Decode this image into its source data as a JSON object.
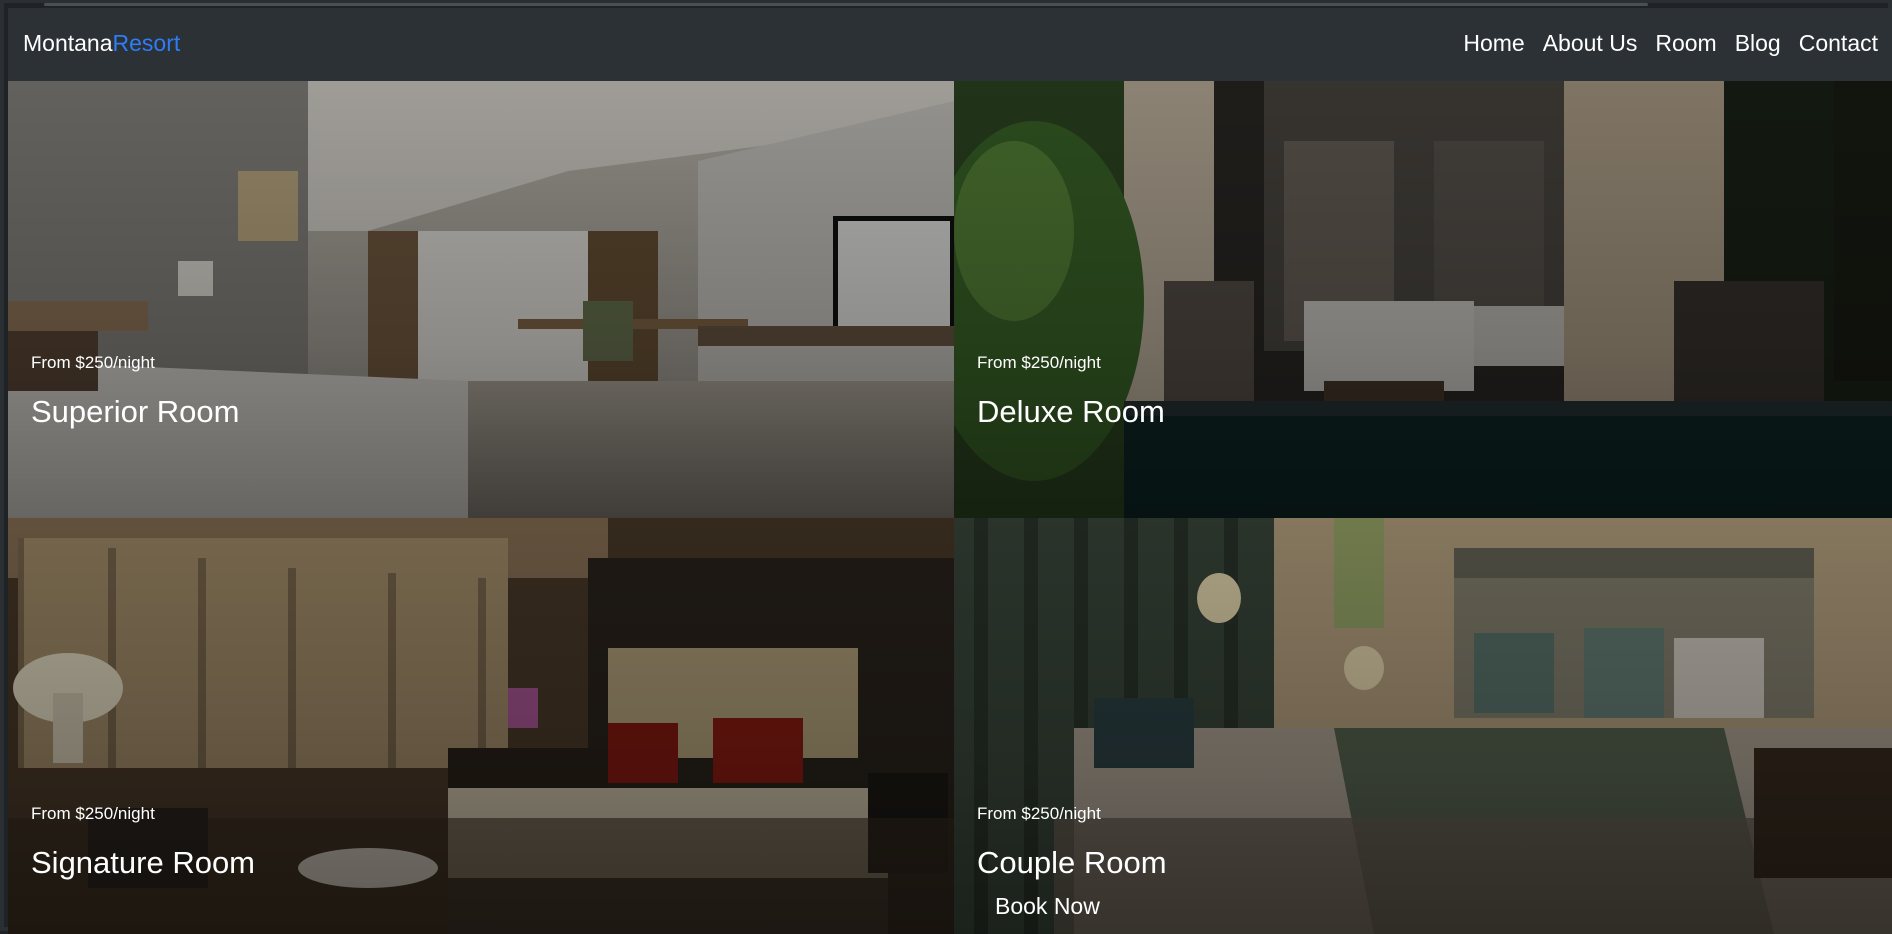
{
  "header": {
    "brand_main": "Montana",
    "brand_accent": "Resort",
    "nav": [
      "Home",
      "About Us",
      "Room",
      "Blog",
      "Contact"
    ]
  },
  "rooms": [
    {
      "price": "From $250/night",
      "name": "Superior Room"
    },
    {
      "price": "From $250/night",
      "name": "Deluxe Room"
    },
    {
      "price": "From $250/night",
      "name": "Signature Room"
    },
    {
      "price": "From $250/night",
      "name": "Couple Room",
      "cta": "Book Now"
    }
  ],
  "colors": {
    "navbar_bg": "#2b3135",
    "brand_accent": "#2e7cf6",
    "text": "#ffffff"
  }
}
